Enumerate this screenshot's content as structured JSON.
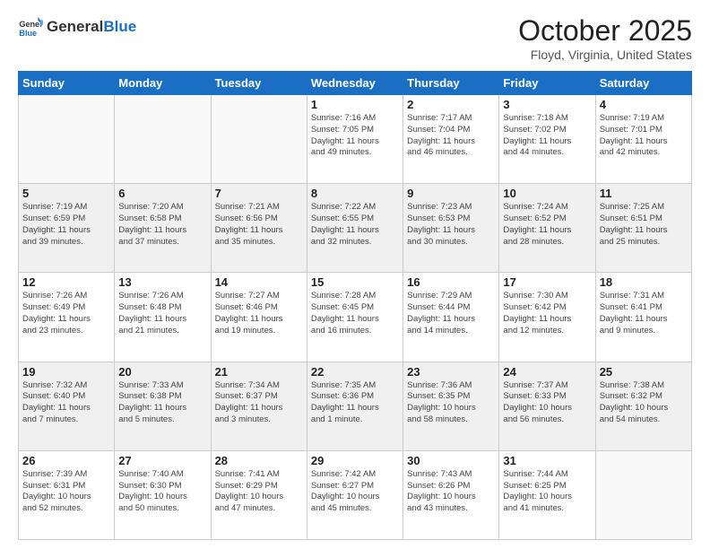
{
  "header": {
    "logo_general": "General",
    "logo_blue": "Blue",
    "month": "October 2025",
    "location": "Floyd, Virginia, United States"
  },
  "days_of_week": [
    "Sunday",
    "Monday",
    "Tuesday",
    "Wednesday",
    "Thursday",
    "Friday",
    "Saturday"
  ],
  "weeks": [
    [
      {
        "day": "",
        "info": ""
      },
      {
        "day": "",
        "info": ""
      },
      {
        "day": "",
        "info": ""
      },
      {
        "day": "1",
        "info": "Sunrise: 7:16 AM\nSunset: 7:05 PM\nDaylight: 11 hours\nand 49 minutes."
      },
      {
        "day": "2",
        "info": "Sunrise: 7:17 AM\nSunset: 7:04 PM\nDaylight: 11 hours\nand 46 minutes."
      },
      {
        "day": "3",
        "info": "Sunrise: 7:18 AM\nSunset: 7:02 PM\nDaylight: 11 hours\nand 44 minutes."
      },
      {
        "day": "4",
        "info": "Sunrise: 7:19 AM\nSunset: 7:01 PM\nDaylight: 11 hours\nand 42 minutes."
      }
    ],
    [
      {
        "day": "5",
        "info": "Sunrise: 7:19 AM\nSunset: 6:59 PM\nDaylight: 11 hours\nand 39 minutes."
      },
      {
        "day": "6",
        "info": "Sunrise: 7:20 AM\nSunset: 6:58 PM\nDaylight: 11 hours\nand 37 minutes."
      },
      {
        "day": "7",
        "info": "Sunrise: 7:21 AM\nSunset: 6:56 PM\nDaylight: 11 hours\nand 35 minutes."
      },
      {
        "day": "8",
        "info": "Sunrise: 7:22 AM\nSunset: 6:55 PM\nDaylight: 11 hours\nand 32 minutes."
      },
      {
        "day": "9",
        "info": "Sunrise: 7:23 AM\nSunset: 6:53 PM\nDaylight: 11 hours\nand 30 minutes."
      },
      {
        "day": "10",
        "info": "Sunrise: 7:24 AM\nSunset: 6:52 PM\nDaylight: 11 hours\nand 28 minutes."
      },
      {
        "day": "11",
        "info": "Sunrise: 7:25 AM\nSunset: 6:51 PM\nDaylight: 11 hours\nand 25 minutes."
      }
    ],
    [
      {
        "day": "12",
        "info": "Sunrise: 7:26 AM\nSunset: 6:49 PM\nDaylight: 11 hours\nand 23 minutes."
      },
      {
        "day": "13",
        "info": "Sunrise: 7:26 AM\nSunset: 6:48 PM\nDaylight: 11 hours\nand 21 minutes."
      },
      {
        "day": "14",
        "info": "Sunrise: 7:27 AM\nSunset: 6:46 PM\nDaylight: 11 hours\nand 19 minutes."
      },
      {
        "day": "15",
        "info": "Sunrise: 7:28 AM\nSunset: 6:45 PM\nDaylight: 11 hours\nand 16 minutes."
      },
      {
        "day": "16",
        "info": "Sunrise: 7:29 AM\nSunset: 6:44 PM\nDaylight: 11 hours\nand 14 minutes."
      },
      {
        "day": "17",
        "info": "Sunrise: 7:30 AM\nSunset: 6:42 PM\nDaylight: 11 hours\nand 12 minutes."
      },
      {
        "day": "18",
        "info": "Sunrise: 7:31 AM\nSunset: 6:41 PM\nDaylight: 11 hours\nand 9 minutes."
      }
    ],
    [
      {
        "day": "19",
        "info": "Sunrise: 7:32 AM\nSunset: 6:40 PM\nDaylight: 11 hours\nand 7 minutes."
      },
      {
        "day": "20",
        "info": "Sunrise: 7:33 AM\nSunset: 6:38 PM\nDaylight: 11 hours\nand 5 minutes."
      },
      {
        "day": "21",
        "info": "Sunrise: 7:34 AM\nSunset: 6:37 PM\nDaylight: 11 hours\nand 3 minutes."
      },
      {
        "day": "22",
        "info": "Sunrise: 7:35 AM\nSunset: 6:36 PM\nDaylight: 11 hours\nand 1 minute."
      },
      {
        "day": "23",
        "info": "Sunrise: 7:36 AM\nSunset: 6:35 PM\nDaylight: 10 hours\nand 58 minutes."
      },
      {
        "day": "24",
        "info": "Sunrise: 7:37 AM\nSunset: 6:33 PM\nDaylight: 10 hours\nand 56 minutes."
      },
      {
        "day": "25",
        "info": "Sunrise: 7:38 AM\nSunset: 6:32 PM\nDaylight: 10 hours\nand 54 minutes."
      }
    ],
    [
      {
        "day": "26",
        "info": "Sunrise: 7:39 AM\nSunset: 6:31 PM\nDaylight: 10 hours\nand 52 minutes."
      },
      {
        "day": "27",
        "info": "Sunrise: 7:40 AM\nSunset: 6:30 PM\nDaylight: 10 hours\nand 50 minutes."
      },
      {
        "day": "28",
        "info": "Sunrise: 7:41 AM\nSunset: 6:29 PM\nDaylight: 10 hours\nand 47 minutes."
      },
      {
        "day": "29",
        "info": "Sunrise: 7:42 AM\nSunset: 6:27 PM\nDaylight: 10 hours\nand 45 minutes."
      },
      {
        "day": "30",
        "info": "Sunrise: 7:43 AM\nSunset: 6:26 PM\nDaylight: 10 hours\nand 43 minutes."
      },
      {
        "day": "31",
        "info": "Sunrise: 7:44 AM\nSunset: 6:25 PM\nDaylight: 10 hours\nand 41 minutes."
      },
      {
        "day": "",
        "info": ""
      }
    ]
  ]
}
